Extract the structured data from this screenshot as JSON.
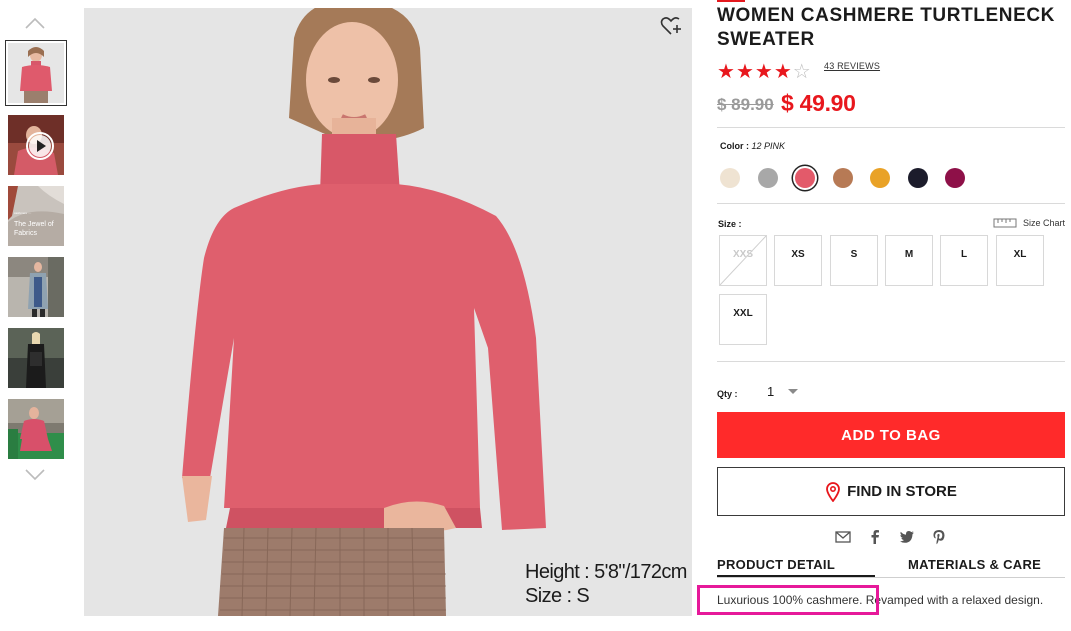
{
  "gallery": {
    "up_arrow_icon": "chevron-up-icon",
    "down_arrow_icon": "chevron-down-icon",
    "thumb4_text": "The Jewel of Fabrics",
    "main_caption_height": "Height : 5'8\"/172cm",
    "main_caption_size": "Size : S",
    "favorite_icon": "heart-plus-icon"
  },
  "product": {
    "title": "WOMEN CASHMERE TURTLENECK SWEATER",
    "rating": {
      "value": 4,
      "max": 5
    },
    "reviews_label": "43 REVIEWS",
    "price_original": "$ 89.90",
    "price_sale": "$ 49.90",
    "color_label": "Color :",
    "color_value": "12 PINK",
    "colors": [
      "#efe3d2",
      "#a8a8a8",
      "#e35a6a",
      "#b77a55",
      "#e9a227",
      "#1c1c2b",
      "#8e1048"
    ],
    "selected_color_index": 2,
    "size_label": "Size :",
    "size_chart_label": "Size Chart",
    "sizes": [
      "XXS",
      "XS",
      "S",
      "M",
      "L",
      "XL",
      "XXL"
    ],
    "unavailable_sizes": [
      "XXS"
    ],
    "qty_label": "Qty :",
    "qty_value": "1",
    "add_to_bag": "ADD TO BAG",
    "find_in_store": "FIND IN STORE",
    "share_icons": [
      "mail-icon",
      "facebook-icon",
      "twitter-icon",
      "pinterest-icon"
    ],
    "tabs": [
      "PRODUCT DETAIL",
      "MATERIALS & CARE"
    ],
    "active_tab": "PRODUCT DETAIL",
    "description": "Luxurious 100% cashmere. Revamped with a relaxed design."
  },
  "colors": {
    "accent_red": "#ff2a2a",
    "price_red": "#e8171d",
    "highlight_magenta": "#e6199a"
  }
}
